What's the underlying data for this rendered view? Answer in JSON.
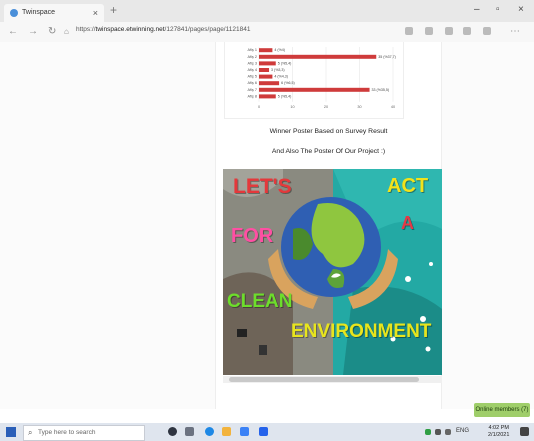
{
  "browser": {
    "tab_title": "Twinspace",
    "url_prefix": "https://",
    "url_host": "twinspace.etwinning.net",
    "url_path": "/127841/pages/page/1121841",
    "new_tab": "+",
    "window_controls": [
      "–",
      "▫",
      "×"
    ]
  },
  "chart_data": {
    "type": "bar",
    "orientation": "horizontal",
    "categories": [
      "Afiş 1",
      "Afiş 2",
      "Afiş 3",
      "Afiş 4",
      "Afiş 5",
      "Afiş 6",
      "Afiş 7",
      "Afiş 8"
    ],
    "values": [
      4,
      35,
      5,
      3,
      4,
      6,
      33,
      5
    ],
    "data_labels": [
      "4 (%4)",
      "35 (%37,7)",
      "5 (%5,4)",
      "3 (%3,3)",
      "4 (%4,3)",
      "6 (%6,5)",
      "33 (%35,5)",
      "5 (%5,4)"
    ],
    "x_ticks": [
      "0",
      "10",
      "20",
      "30",
      "40"
    ],
    "xlim": [
      0,
      40
    ],
    "bar_color": "#cf3b3b",
    "grid": true
  },
  "content": {
    "caption_line1": "Winner Poster Based on Survey Result",
    "caption_line2": "And Also The Poster Of Our Project :)"
  },
  "poster": {
    "words": [
      "LET'S",
      "ACT",
      "A",
      "FOR",
      "CLEAN",
      "ENVIRONMENT"
    ],
    "colors": {
      "lets": "#e5383b",
      "act": "#f2e21a",
      "a": "#e63946",
      "for": "#ff4fa3",
      "clean": "#6dde2b",
      "environment": "#e8e51d"
    }
  },
  "online_members": "Online members (7)",
  "taskbar": {
    "search_placeholder": "Type here to search",
    "language": "ENG",
    "time": "4:02 PM",
    "date": "2/1/2021"
  },
  "colors": {
    "taskbar": "#dfe5ee",
    "accent": "#2b5fb8",
    "online_badge": "#9fce6a"
  }
}
